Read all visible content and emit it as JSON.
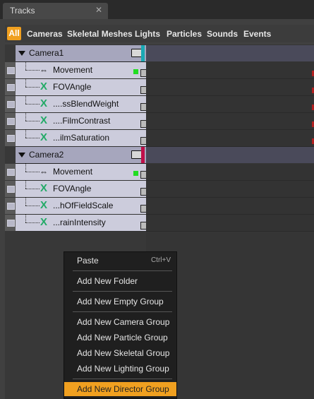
{
  "tab": {
    "title": "Tracks",
    "close": "✕"
  },
  "filters": [
    "All",
    "Cameras",
    "Skeletal Meshes",
    "Lights",
    "Particles",
    "Sounds",
    "Events"
  ],
  "groups": [
    {
      "name": "Camera1",
      "color": "#1aa9b4",
      "tracks": [
        {
          "label": "Movement",
          "icon": "movement-icon"
        },
        {
          "label": "FOVAngle",
          "icon": "x-track-icon"
        },
        {
          "label": "....ssBlendWeight",
          "icon": "x-track-icon"
        },
        {
          "label": "....FilmContrast",
          "icon": "x-track-icon"
        },
        {
          "label": "...ilmSaturation",
          "icon": "x-track-icon"
        }
      ]
    },
    {
      "name": "Camera2",
      "color": "#c0104a",
      "tracks": [
        {
          "label": "Movement",
          "icon": "movement-icon"
        },
        {
          "label": "FOVAngle",
          "icon": "x-track-icon"
        },
        {
          "label": "...hOfFieldScale",
          "icon": "x-track-icon"
        },
        {
          "label": "...rainIntensity",
          "icon": "x-track-icon"
        }
      ]
    }
  ],
  "context_menu": {
    "paste": "Paste",
    "paste_shortcut": "Ctrl+V",
    "add_new_folder": "Add New Folder",
    "add_new_empty_group": "Add New Empty Group",
    "add_new_camera_group": "Add New Camera Group",
    "add_new_particle_group": "Add New Particle Group",
    "add_new_skeletal_group": "Add New Skeletal Group",
    "add_new_lighting_group": "Add New Lighting Group",
    "add_new_director_group": "Add New Director Group"
  }
}
